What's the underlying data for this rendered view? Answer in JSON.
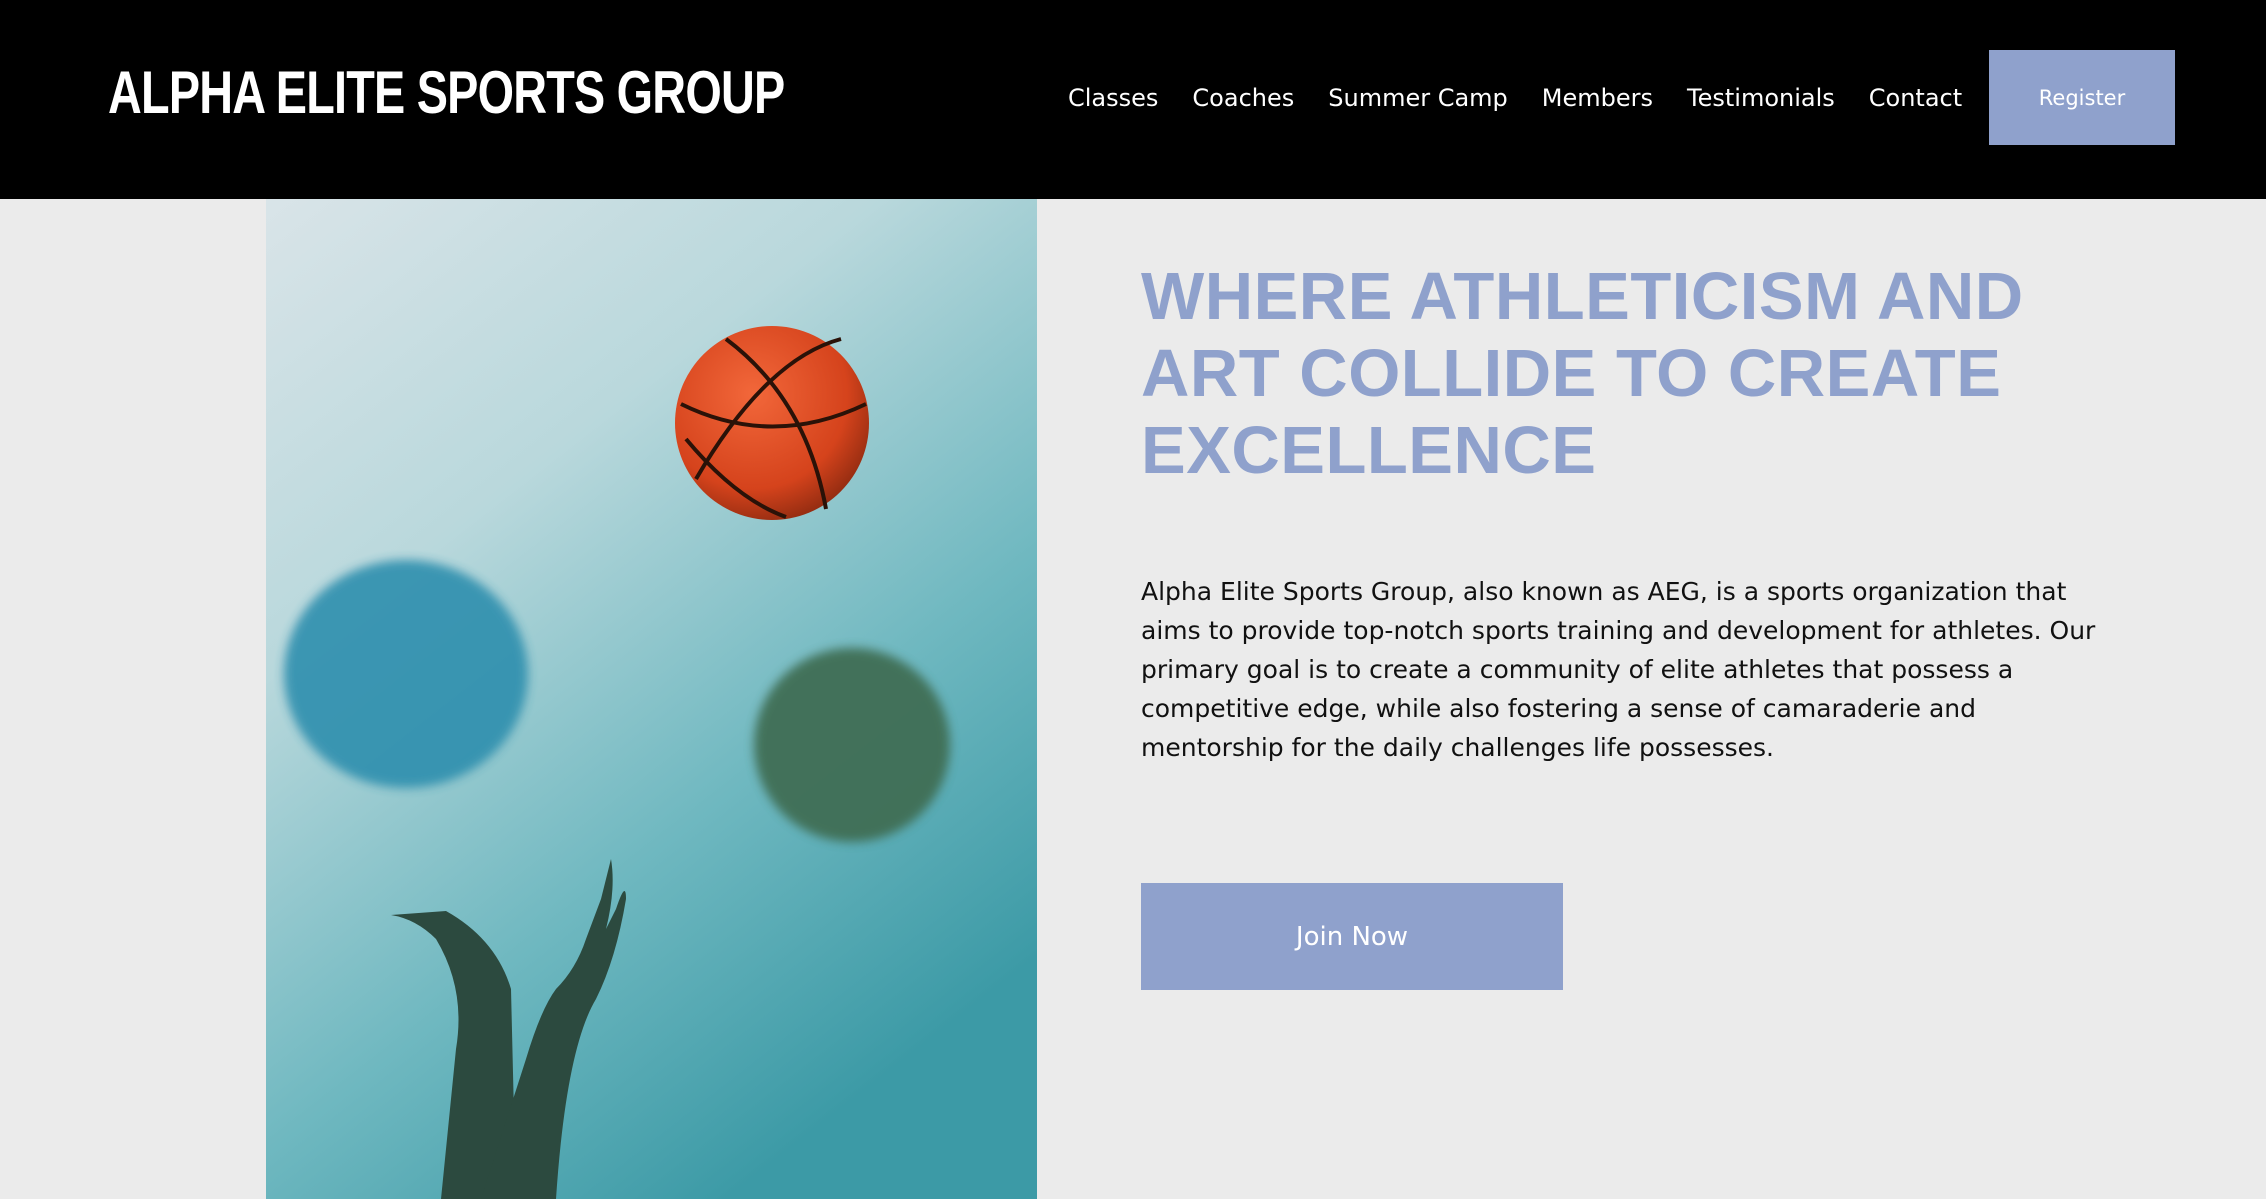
{
  "header": {
    "logo": "ALPHA ELITE SPORTS GROUP",
    "nav": [
      "Classes",
      "Coaches",
      "Summer Camp",
      "Members",
      "Testimonials",
      "Contact"
    ],
    "register_label": "Register"
  },
  "hero": {
    "headline_lines": [
      "WHERE ATHLETICISM AND",
      "ART COLLIDE TO CREATE",
      "EXCELLENCE"
    ],
    "body_lines": [
      "Alpha Elite Sports Group, also known as AEG, is a sports organization that",
      "aims to provide top-notch sports training and development for athletes. Our",
      "primary goal is to create a community of elite athletes that possess a",
      "competitive edge, while also fostering a sense of camaraderie and",
      "mentorship for the daily challenges life possesses."
    ],
    "join_label": "Join Now",
    "image": "basketball-toss-photo"
  },
  "colors": {
    "accent": "#8fa1cc",
    "header_bg": "#000000",
    "page_bg": "#ebebeb"
  }
}
